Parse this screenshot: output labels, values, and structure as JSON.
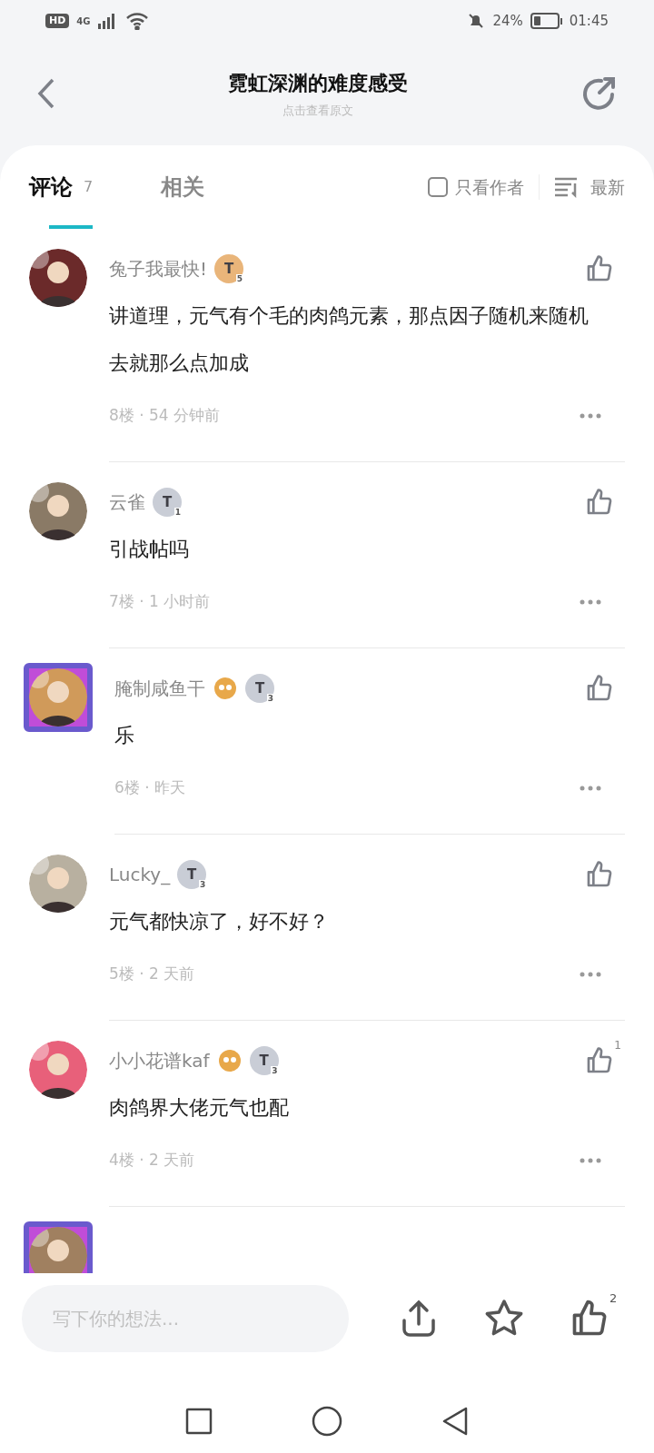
{
  "status_bar": {
    "hd": "HD",
    "network": "4G",
    "battery_text": "24%",
    "time": "01:45"
  },
  "header": {
    "title": "霓虹深渊的难度感受",
    "subtitle": "点击查看原文"
  },
  "tabs": [
    {
      "label": "评论",
      "count": "7",
      "selected": true
    },
    {
      "label": "相关",
      "selected": false
    }
  ],
  "filter": {
    "label": "只看作者",
    "checked": false
  },
  "sort": {
    "label": "最新"
  },
  "comments": [
    {
      "user": "兔子我最快!",
      "badge": {
        "letter": "T",
        "level": "5",
        "color": "#e9b57a"
      },
      "sticker": false,
      "frame": false,
      "text": "讲道理，元气有个毛的肉鸽元素，那点因子随机来随机去就那么点加成",
      "meta": "8楼 · 54 分钟前"
    },
    {
      "user": "云雀",
      "badge": {
        "letter": "T",
        "level": "1",
        "color": "#c9cdd6"
      },
      "sticker": false,
      "frame": false,
      "text": "引战帖吗",
      "meta": "7楼 · 1 小时前"
    },
    {
      "user": "腌制咸鱼干",
      "badge": {
        "letter": "T",
        "level": "3",
        "color": "#c9cdd6"
      },
      "sticker": true,
      "frame": true,
      "text": "乐",
      "meta": "6楼 · 昨天"
    },
    {
      "user": "Lucky_",
      "badge": {
        "letter": "T",
        "level": "3",
        "color": "#c9cdd6"
      },
      "sticker": false,
      "frame": false,
      "text": "元气都快凉了，好不好？",
      "meta": "5楼 · 2 天前"
    },
    {
      "user": "小小花谱kaf",
      "badge": {
        "letter": "T",
        "level": "3",
        "color": "#c9cdd6"
      },
      "sticker": true,
      "frame": false,
      "text": "肉鸽界大佬元气也配",
      "meta": "4楼 · 2 天前",
      "likes": "1"
    },
    {
      "frame": true,
      "partial": true
    }
  ],
  "composer": {
    "placeholder": "写下你的想法..."
  },
  "actions": {
    "like_count": "2"
  }
}
